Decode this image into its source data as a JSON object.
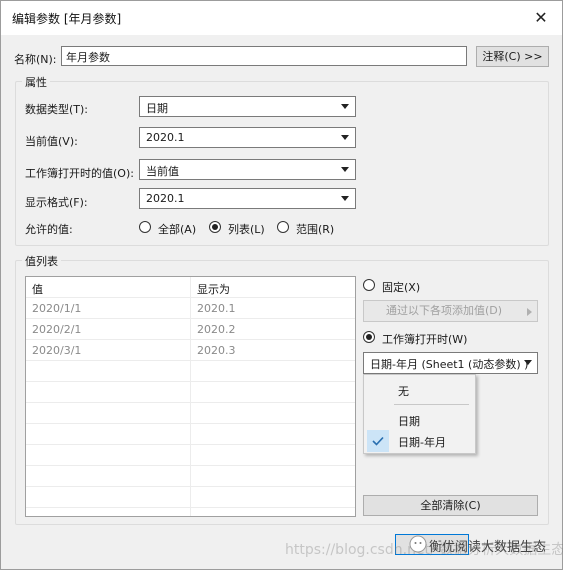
{
  "window": {
    "title": "编辑参数 [年月参数]",
    "close_glyph": "✕"
  },
  "name": {
    "label": "名称(N):",
    "value": "年月参数",
    "comment_button": "注释(C) >>"
  },
  "properties": {
    "group_title": "属性",
    "data_type": {
      "label": "数据类型(T):",
      "value": "日期"
    },
    "current_value": {
      "label": "当前值(V):",
      "value": "2020.1"
    },
    "open_value": {
      "label": "工作簿打开时的值(O):",
      "value": "当前值"
    },
    "display_format": {
      "label": "显示格式(F):",
      "value": "2020.1"
    },
    "allowable": {
      "label": "允许的值:",
      "options": [
        {
          "label": "全部(A)",
          "selected": false
        },
        {
          "label": "列表(L)",
          "selected": true
        },
        {
          "label": "范围(R)",
          "selected": false
        }
      ]
    }
  },
  "value_list": {
    "group_title": "值列表",
    "columns": [
      "值",
      "显示为"
    ],
    "rows": [
      [
        "2020/1/1",
        "2020.1"
      ],
      [
        "2020/2/1",
        "2020.2"
      ],
      [
        "2020/3/1",
        "2020.3"
      ]
    ],
    "fixed_label": "固定(X)",
    "add_from_button": "通过以下各项添加值(D)",
    "when_open_label": "工作簿打开时(W)",
    "field_select": "日期-年月 (Sheet1 (动态参数) )",
    "clear_all_button": "全部清除(C)",
    "dropdown_menu": {
      "items": [
        {
          "label": "无",
          "checked": false
        },
        {
          "label": "日期",
          "checked": false
        },
        {
          "label": "日期-年月",
          "checked": true
        }
      ]
    }
  },
  "watermark": {
    "text": "https://blog.csdn.net/ 数据分析大数据生态"
  },
  "wechat_caption": "衡优阅读大数据生态"
}
